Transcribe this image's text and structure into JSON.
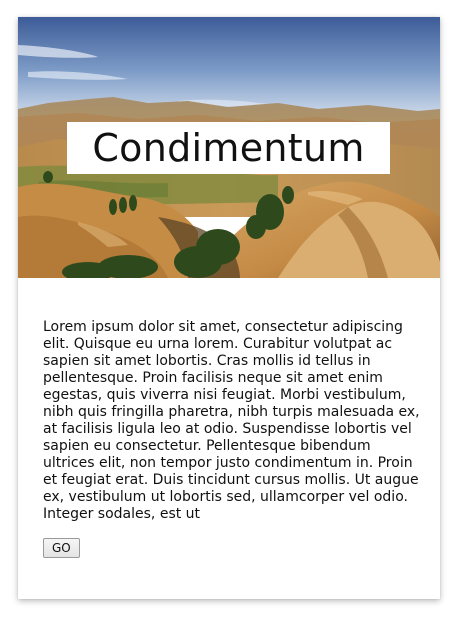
{
  "card": {
    "title": "Condimentum",
    "body": "Lorem ipsum dolor sit amet, consectetur adipiscing elit. Quisque eu urna lorem. Curabitur volutpat ac sapien sit amet lobortis. Cras mollis id tellus in pellentesque. Proin facilisis neque sit amet enim egestas, quis viverra nisi feugiat. Morbi vestibulum, nibh quis fringilla pharetra, nibh turpis malesuada ex, at facilisis ligula leo at odio. Suspendisse lobortis vel sapien eu consectetur. Pellentesque bibendum ultrices elit, non tempor justo condimentum in. Proin et feugiat erat. Duis tincidunt cursus mollis. Ut augue ex, vestibulum ut lobortis sed, ullamcorper vel odio. Integer sodales, est ut",
    "button_label": "GO",
    "image_subject": "landscape-photo of golden hills under blue sky"
  },
  "colors": {
    "sky_top": "#3f5f9a",
    "sky_bottom": "#c9d7ea",
    "hills_gold": "#c9924a",
    "hills_dark": "#5b4a2a",
    "trees": "#2f4a1e"
  }
}
